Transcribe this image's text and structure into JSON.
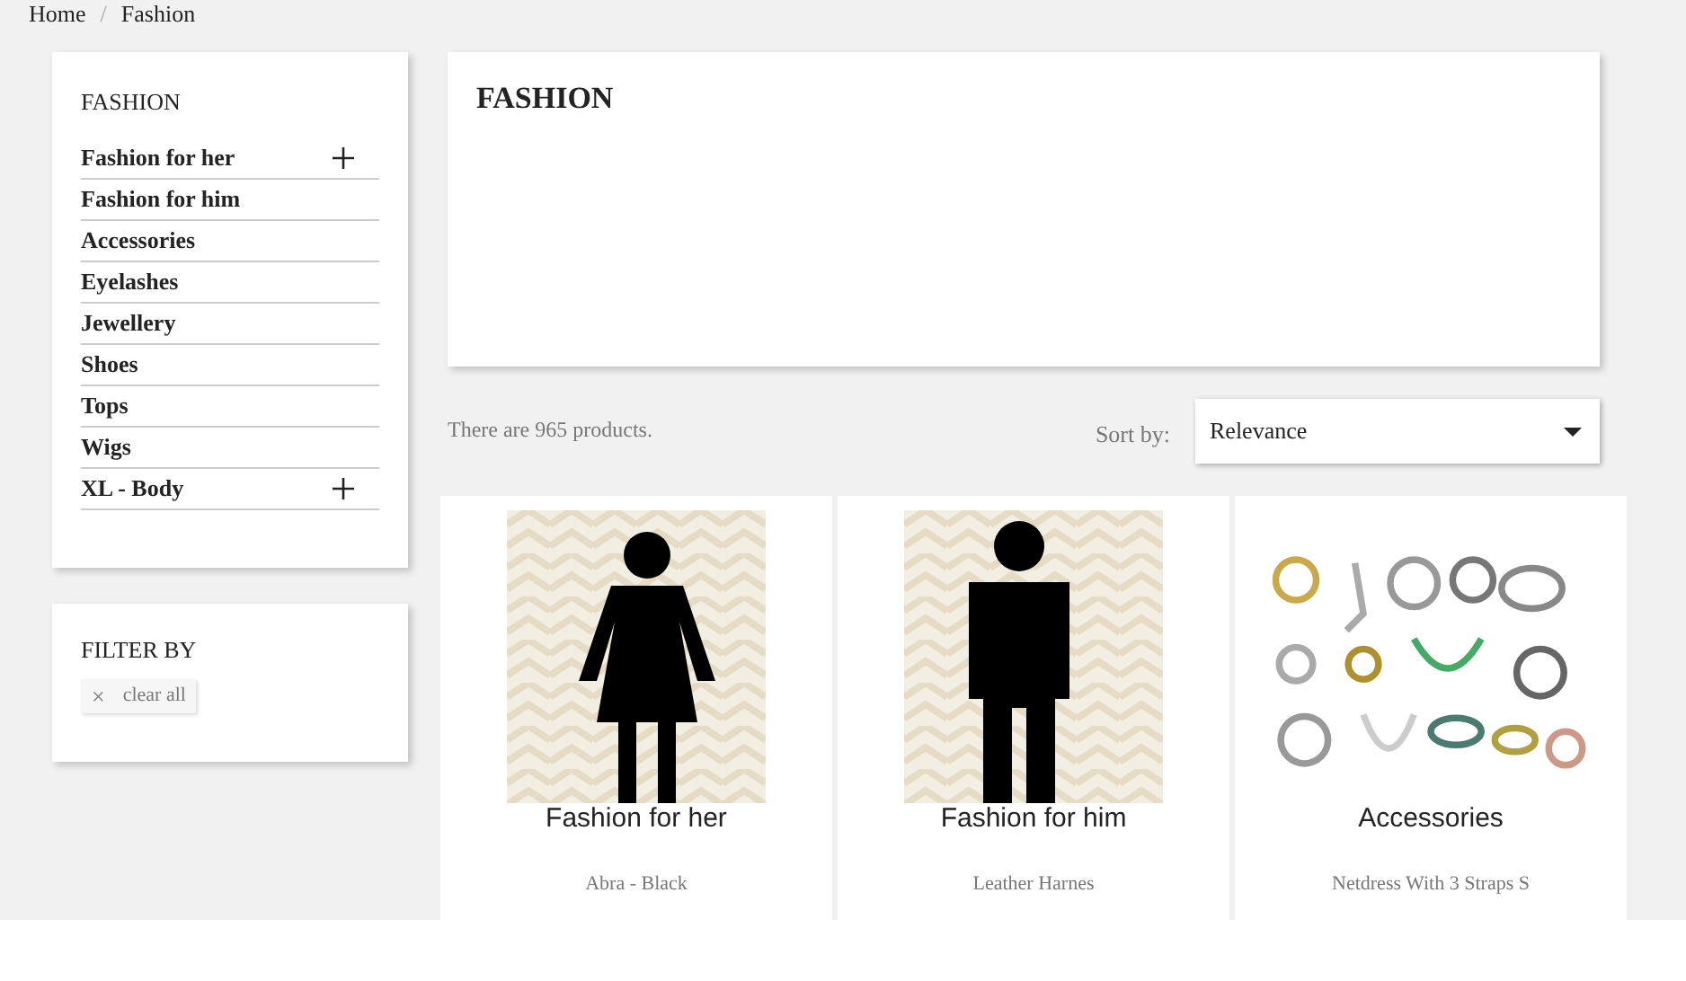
{
  "breadcrumb": [
    "Home",
    "Fashion"
  ],
  "breadcrumb_separator": "/",
  "category_block": {
    "title": "FASHION",
    "items": [
      {
        "label": "Fashion for her",
        "expandable": true
      },
      {
        "label": "Fashion for him",
        "expandable": false
      },
      {
        "label": "Accessories",
        "expandable": false
      },
      {
        "label": "Eyelashes",
        "expandable": false
      },
      {
        "label": "Jewellery",
        "expandable": false
      },
      {
        "label": "Shoes",
        "expandable": false
      },
      {
        "label": "Tops",
        "expandable": false
      },
      {
        "label": "Wigs",
        "expandable": false
      },
      {
        "label": "XL - Body",
        "expandable": true
      }
    ]
  },
  "filter_block": {
    "title": "FILTER BY",
    "clear_icon": "×",
    "clear_label": "clear all"
  },
  "category_header": {
    "title": "FASHION"
  },
  "product_count": "There are 965 products.",
  "sort": {
    "label": "Sort by:",
    "value": "Relevance"
  },
  "products": [
    {
      "kind": "woman",
      "image_caption": "Fashion for her",
      "name": "Abra - Black"
    },
    {
      "kind": "man",
      "image_caption": "Fashion for him",
      "name": "Leather Harnes"
    },
    {
      "kind": "jewellery",
      "image_caption": "Accessories",
      "name": "Netdress With 3 Straps S"
    }
  ]
}
